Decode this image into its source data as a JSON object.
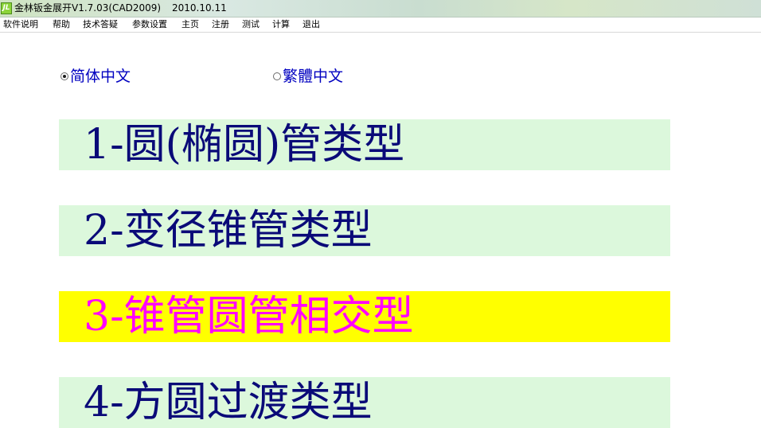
{
  "window": {
    "title": "金林钣金展开V1.7.03(CAD2009)",
    "date": "2010.10.11",
    "icon": "app-logo-icon"
  },
  "menu": {
    "items": [
      {
        "label": "软件说明"
      },
      {
        "label": "帮助"
      },
      {
        "label": "技术答疑"
      },
      {
        "label": "参数设置"
      },
      {
        "label": "主页"
      },
      {
        "label": "注册"
      },
      {
        "label": "测试"
      },
      {
        "label": "计算"
      },
      {
        "label": "退出"
      }
    ]
  },
  "language": {
    "options": [
      {
        "label": "简体中文",
        "selected": true
      },
      {
        "label": "繁體中文",
        "selected": false
      }
    ]
  },
  "types": {
    "items": [
      {
        "label": "1-圆(椭圆)管类型",
        "highlighted": false
      },
      {
        "label": "2-变径锥管类型",
        "highlighted": false
      },
      {
        "label": "3-锥管圆管相交型",
        "highlighted": true
      },
      {
        "label": "4-方圆过渡类型",
        "highlighted": false
      }
    ]
  },
  "colors": {
    "button_bg": "#dcf8dc",
    "button_text": "#0a0a78",
    "highlight_bg": "#ffff00",
    "highlight_text": "#ff00ff",
    "radio_text": "#0000c0"
  }
}
